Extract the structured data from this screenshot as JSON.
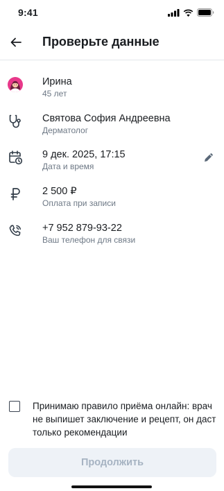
{
  "status_bar": {
    "time": "9:41"
  },
  "header": {
    "title": "Проверьте данные"
  },
  "rows": [
    {
      "main": "Ирина",
      "sub": "45 лет",
      "icon": "patient-avatar"
    },
    {
      "main": "Святова София Андреевна",
      "sub": "Дерматолог",
      "icon": "stethoscope-icon"
    },
    {
      "main": "9 дек. 2025, 17:15",
      "sub": "Дата и время",
      "icon": "calendar-clock-icon"
    },
    {
      "main": "2 500 ₽",
      "sub": "Оплата при записи",
      "icon": "ruble-icon"
    },
    {
      "main": "+7 952 879-93-22",
      "sub": "Ваш телефон для связи",
      "icon": "phone-icon"
    }
  ],
  "consent": {
    "text": "Принимаю правило приёма онлайн: врач не выпишет заключение и рецепт, он даст только рекомендации",
    "checked": false
  },
  "footer": {
    "continue_label": "Продолжить"
  },
  "colors": {
    "accent_disabled_bg": "#eef2f7",
    "accent_disabled_text": "#a6b3c2",
    "secondary_text": "#6d7885"
  }
}
